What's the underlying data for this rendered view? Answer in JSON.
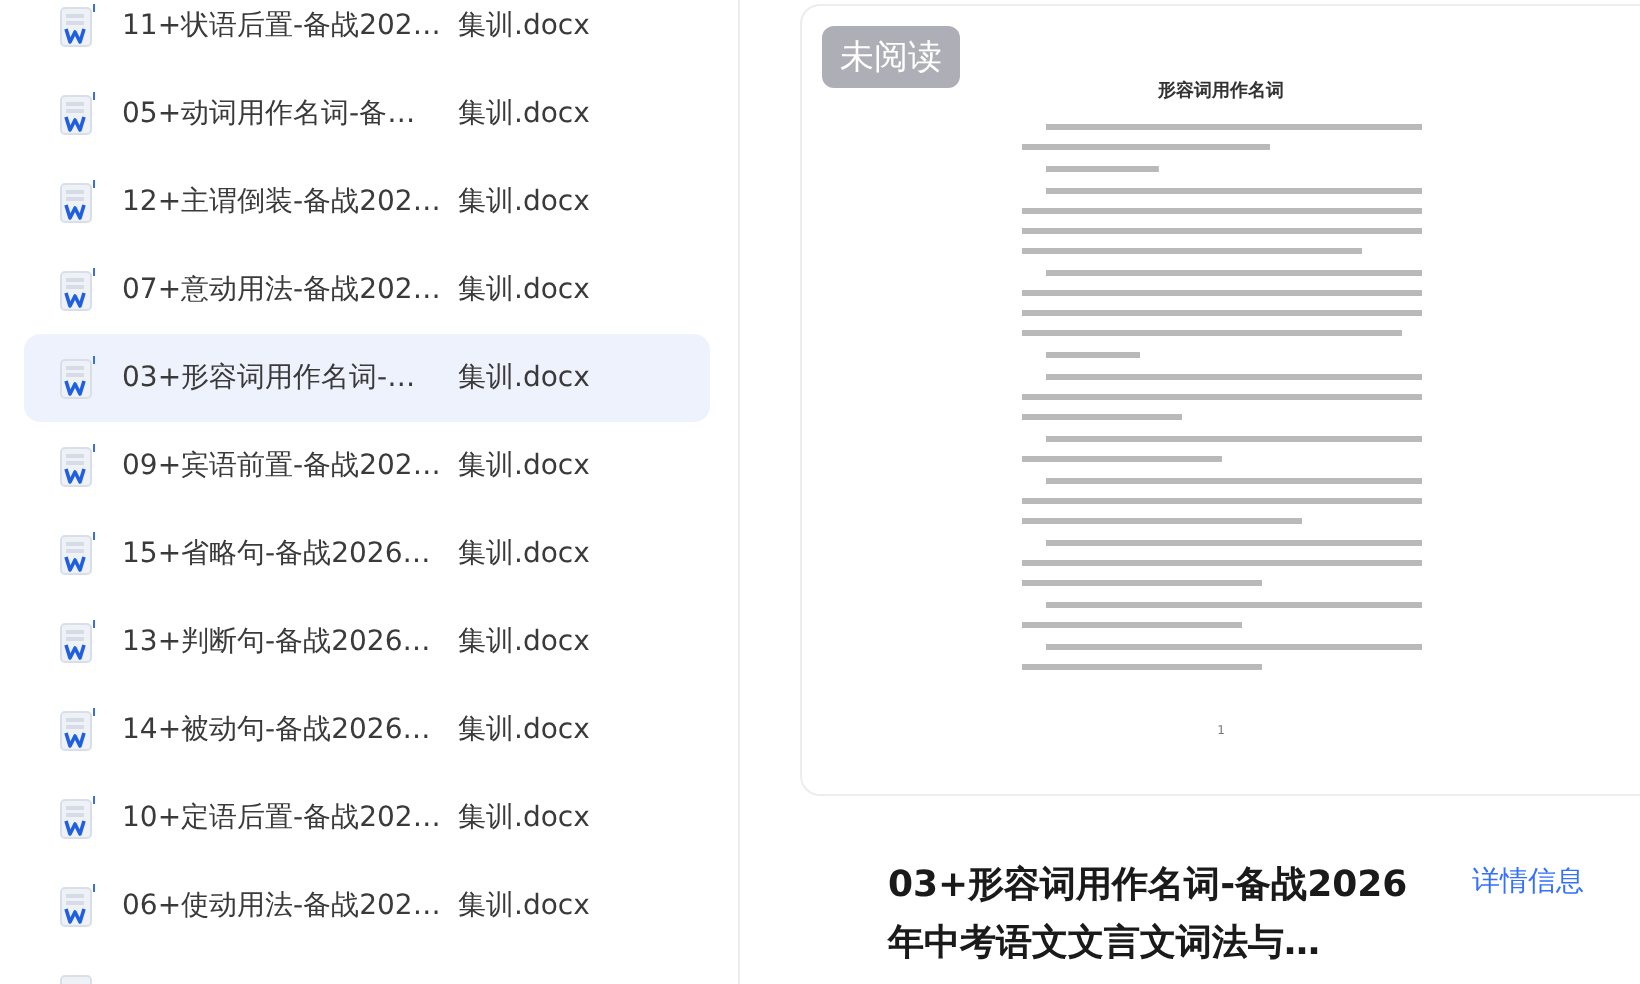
{
  "files": [
    {
      "name_start": "11+状语后置-备战202…",
      "name_end": "集训.docx",
      "selected": false
    },
    {
      "name_start": "05+动词用作名词-备…",
      "name_end": "集训.docx",
      "selected": false
    },
    {
      "name_start": "12+主谓倒装-备战202…",
      "name_end": "集训.docx",
      "selected": false
    },
    {
      "name_start": "07+意动用法-备战202…",
      "name_end": "集训.docx",
      "selected": false
    },
    {
      "name_start": "03+形容词用作名词-…",
      "name_end": "集训.docx",
      "selected": true
    },
    {
      "name_start": "09+宾语前置-备战202…",
      "name_end": "集训.docx",
      "selected": false
    },
    {
      "name_start": "15+省略句-备战2026…",
      "name_end": "集训.docx",
      "selected": false
    },
    {
      "name_start": "13+判断句-备战2026…",
      "name_end": "集训.docx",
      "selected": false
    },
    {
      "name_start": "14+被动句-备战2026…",
      "name_end": "集训.docx",
      "selected": false
    },
    {
      "name_start": "10+定语后置-备战202…",
      "name_end": "集训.docx",
      "selected": false
    },
    {
      "name_start": "06+使动用法-备战202…",
      "name_end": "集训.docx",
      "selected": false
    }
  ],
  "preview": {
    "badge": "未阅读",
    "page_title": "形容词用作名词",
    "page_number": "1"
  },
  "details": {
    "title": "03+形容词用作名词-备战2026年中考语文文言文词法与…",
    "link": "详情信息"
  }
}
